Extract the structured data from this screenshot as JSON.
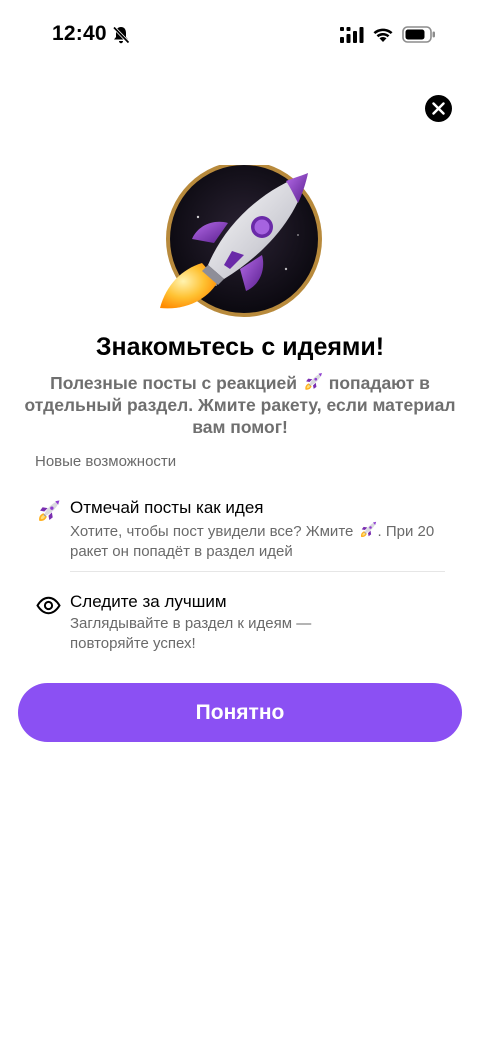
{
  "status_bar": {
    "time": "12:40"
  },
  "icons": {
    "status": [
      "bell-off-icon",
      "signal-icon",
      "wifi-icon",
      "battery-icon"
    ],
    "close": "close-icon",
    "hero": "rocket-badge",
    "feature_1": "rocket-icon",
    "feature_2": "eye-icon"
  },
  "onboarding": {
    "title": "Знакомьтесь с идеями!",
    "subtitle_part1": "Полезные посты с реакцией",
    "subtitle_part2": "попадают в отдельный раздел. Жмите ракету, если материал вам помог!",
    "section_label": "Новые возможности",
    "features": [
      {
        "title": "Отмечай посты как идея",
        "desc_part1": "Хотите, чтобы пост увидели все? Жмите",
        "desc_part2": ". При 20 ракет он попадёт в раздел идей"
      },
      {
        "title": "Следите за лучшим",
        "desc": "Заглядывайте в раздел к идеям — повторяйте успех!"
      }
    ],
    "button_label": "Понятно"
  },
  "colors": {
    "accent": "#8b50f3",
    "text_primary": "#000000",
    "text_secondary": "#6a6a6a",
    "background": "#ffffff"
  }
}
